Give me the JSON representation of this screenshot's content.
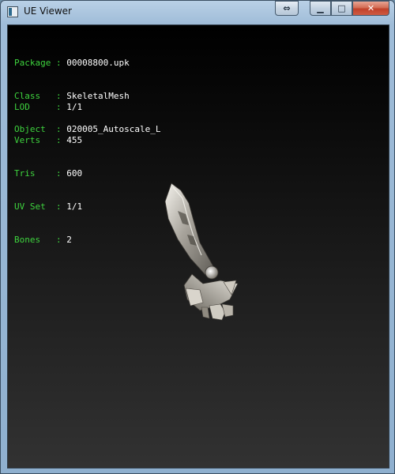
{
  "window": {
    "title": "UE Viewer",
    "icon": "app-window-icon",
    "buttons": {
      "expand": "⇔",
      "minimize": "▁",
      "maximize": "□",
      "close": "✕"
    }
  },
  "info": {
    "object_block": [
      {
        "key": "Package",
        "sep": " : ",
        "value": "00008800.upk"
      },
      {
        "key": "Class  ",
        "sep": " : ",
        "value": "SkeletalMesh"
      },
      {
        "key": "Object ",
        "sep": " : ",
        "value": "020005_Autoscale_L"
      }
    ],
    "mesh_block": [
      {
        "key": "LOD    ",
        "sep": " : ",
        "value": "1/1"
      },
      {
        "key": "Verts  ",
        "sep": " : ",
        "value": "455"
      },
      {
        "key": "Tris   ",
        "sep": " : ",
        "value": "600"
      },
      {
        "key": "UV Set ",
        "sep": " : ",
        "value": "1/1"
      },
      {
        "key": "Bones  ",
        "sep": " : ",
        "value": "2"
      }
    ]
  },
  "colors": {
    "label": "#3ed33e",
    "value": "#ffffff",
    "viewport_top": "#000000",
    "viewport_bottom": "#323232"
  }
}
